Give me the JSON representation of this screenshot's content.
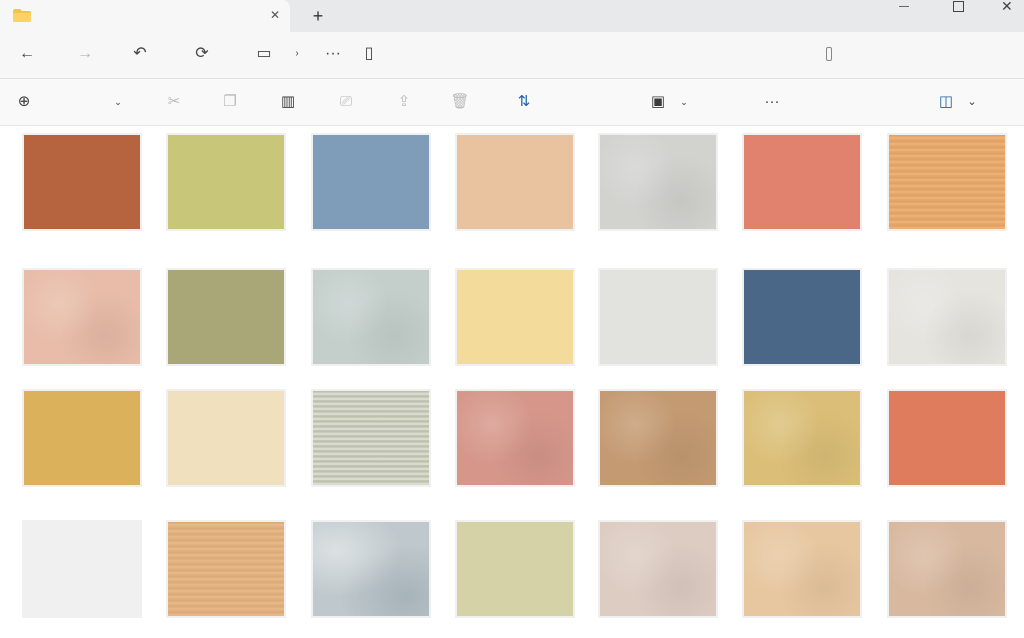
{
  "window": {
    "tab_title": "",
    "new_tab_symbol": "+",
    "tab_close_symbol": "✕",
    "minimize_symbol": "",
    "close_symbol": "✕"
  },
  "nav": {
    "back_icon": "←",
    "forward_icon": "→",
    "up_icon": "↶",
    "refresh_icon": "⟳",
    "view_icon": "▭",
    "chevron_icon": "›",
    "more_icon": "···",
    "expand_icon": "▯",
    "address_text": "",
    "search_placeholder": ""
  },
  "commands": {
    "new_icon": "⊕",
    "chevron": "⌄",
    "cut_icon": "✂",
    "copy_icon": "❐",
    "paste_icon": "▥",
    "rename_icon": "⎚",
    "share_icon": "⇪",
    "delete_icon": "🗑",
    "sort_icon": "⇅",
    "view_icon": "▣",
    "more_icon": "···",
    "details_icon": "◫",
    "details_chev": "⌄"
  },
  "colors": {
    "folder": "#f4c542",
    "accent": "#1f5fa8"
  },
  "files": [
    {
      "name": "",
      "color": "#b5643f",
      "texture": "flat"
    },
    {
      "name": "",
      "color": "#c8c779",
      "texture": "flat"
    },
    {
      "name": "",
      "color": "#7f9cb8",
      "texture": "flat"
    },
    {
      "name": "",
      "color": "#e9c3a0",
      "texture": "flat"
    },
    {
      "name": "",
      "color": "#d2d2cf",
      "texture": "stucco"
    },
    {
      "name": "",
      "color": "#e0826d",
      "texture": "flat"
    },
    {
      "name": "",
      "color": "#e9a96a",
      "texture": "wood"
    },
    {
      "name": "",
      "color": "#e8bca8",
      "texture": "stucco"
    },
    {
      "name": "",
      "color": "#a9a677",
      "texture": "flat"
    },
    {
      "name": "",
      "color": "#c4cfcc",
      "texture": "stucco"
    },
    {
      "name": "",
      "color": "#f3dc9b",
      "texture": "flat"
    },
    {
      "name": "",
      "color": "#e2e2de",
      "texture": "flat"
    },
    {
      "name": "",
      "color": "#4a6787",
      "texture": "flat"
    },
    {
      "name": "",
      "color": "#e6e4df",
      "texture": "stucco"
    },
    {
      "name": "",
      "color": "#dbb15c",
      "texture": "flat"
    },
    {
      "name": "",
      "color": "#f1e0bd",
      "texture": "flat"
    },
    {
      "name": "",
      "color": "#c4c8b4",
      "texture": "lines"
    },
    {
      "name": "",
      "color": "#d6978a",
      "texture": "stucco"
    },
    {
      "name": "",
      "color": "#c49a72",
      "texture": "stucco"
    },
    {
      "name": "",
      "color": "#dbbf78",
      "texture": "stucco"
    },
    {
      "name": "",
      "color": "#e07c5e",
      "texture": "flat"
    },
    {
      "name": "",
      "color": "#f0f0f0",
      "texture": "flat"
    },
    {
      "name": "",
      "color": "#e4b27e",
      "texture": "wood"
    },
    {
      "name": "",
      "color": "#bfc8cc",
      "texture": "wave"
    },
    {
      "name": "",
      "color": "#d5d2a8",
      "texture": "flat"
    },
    {
      "name": "",
      "color": "#ddccc2",
      "texture": "stucco"
    },
    {
      "name": "",
      "color": "#e7c7a0",
      "texture": "stucco"
    },
    {
      "name": "",
      "color": "#d8b9a0",
      "texture": "stucco"
    }
  ]
}
